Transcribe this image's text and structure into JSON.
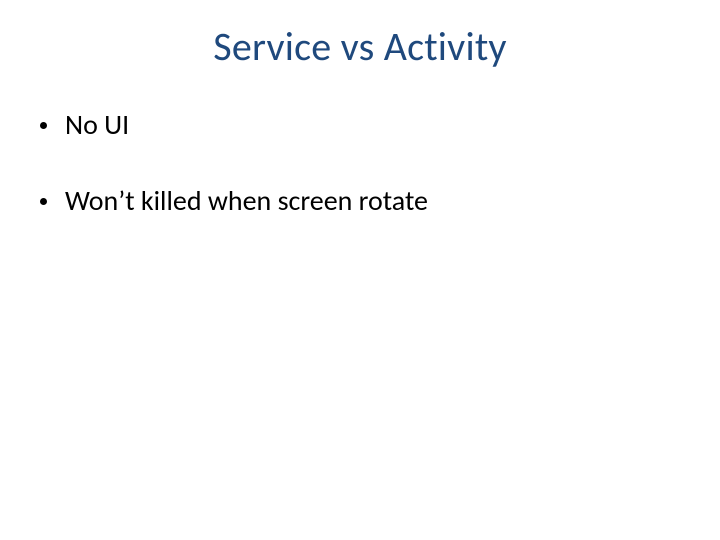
{
  "slide": {
    "title": "Service vs Activity",
    "bullets": [
      {
        "text": "No UI"
      },
      {
        "text": "Won’t killed when screen rotate"
      }
    ]
  }
}
